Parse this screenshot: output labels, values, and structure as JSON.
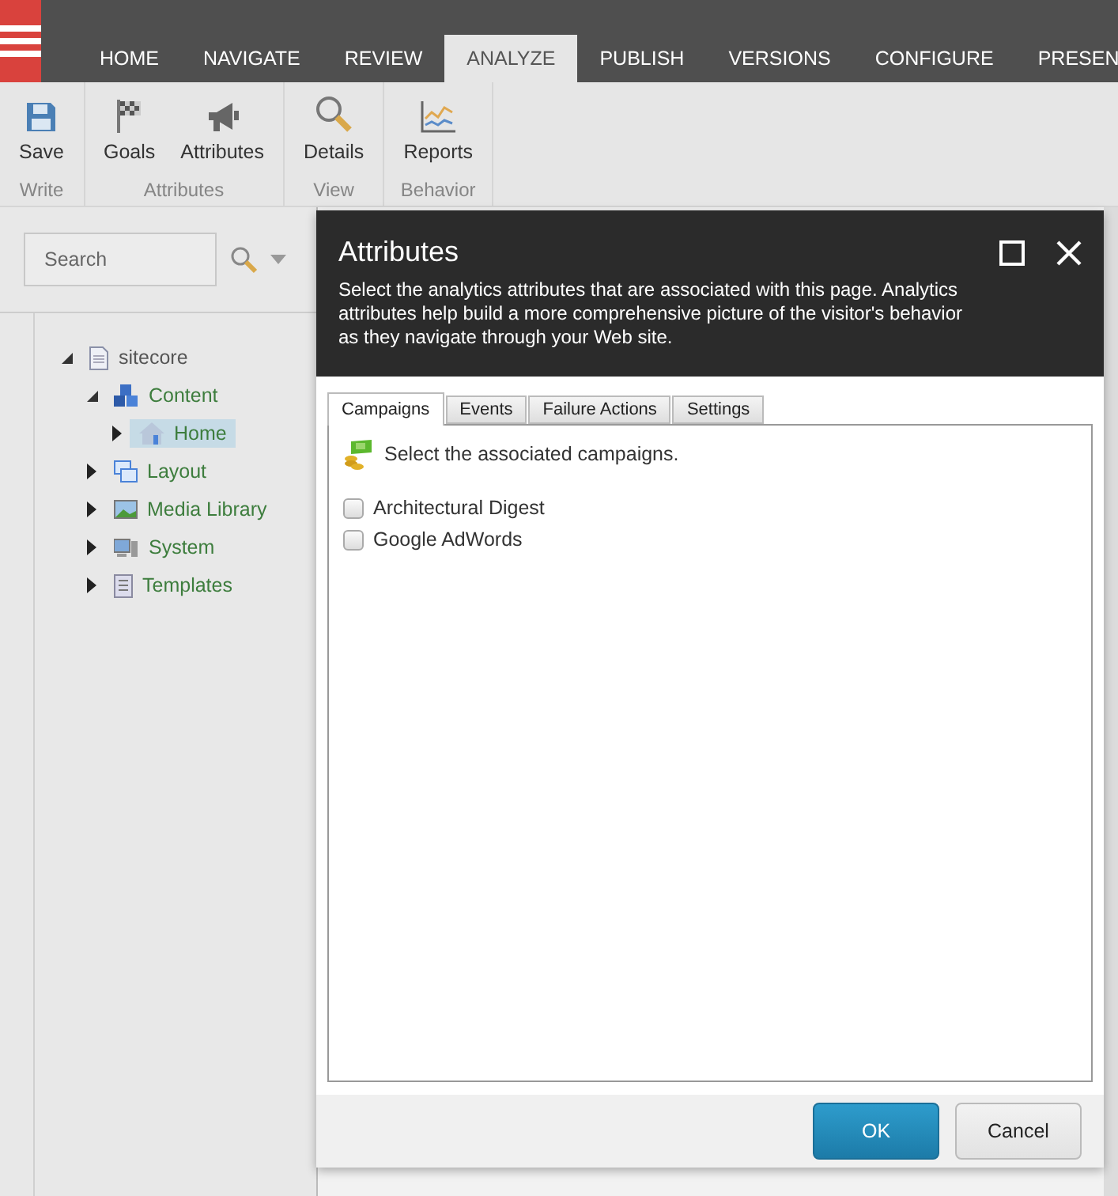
{
  "nav_tabs": [
    {
      "label": "HOME",
      "selected": false
    },
    {
      "label": "NAVIGATE",
      "selected": false
    },
    {
      "label": "REVIEW",
      "selected": false
    },
    {
      "label": "ANALYZE",
      "selected": true
    },
    {
      "label": "PUBLISH",
      "selected": false
    },
    {
      "label": "VERSIONS",
      "selected": false
    },
    {
      "label": "CONFIGURE",
      "selected": false
    },
    {
      "label": "PRESEN",
      "selected": false
    }
  ],
  "ribbon": [
    {
      "label": "Write",
      "buttons": [
        "Save"
      ]
    },
    {
      "label": "Attributes",
      "buttons": [
        "Goals",
        "Attributes"
      ]
    },
    {
      "label": "View",
      "buttons": [
        "Details"
      ]
    },
    {
      "label": "Behavior",
      "buttons": [
        "Reports"
      ]
    }
  ],
  "search": {
    "placeholder": "Search"
  },
  "tree": [
    {
      "label": "sitecore",
      "expanded": true,
      "selected": false,
      "children": [
        {
          "label": "Content",
          "expanded": true,
          "selected": false,
          "children": [
            {
              "label": "Home",
              "expanded": false,
              "selected": true
            }
          ]
        },
        {
          "label": "Layout",
          "expanded": false,
          "selected": false
        },
        {
          "label": "Media Library",
          "expanded": false,
          "selected": false
        },
        {
          "label": "System",
          "expanded": false,
          "selected": false
        },
        {
          "label": "Templates",
          "expanded": false,
          "selected": false
        }
      ]
    }
  ],
  "dialog": {
    "title": "Attributes",
    "description": "Select the analytics attributes that are associated with this page. Analytics attributes help build a more comprehensive picture of the visitor's behavior as they navigate through your Web site.",
    "tabs": [
      {
        "label": "Campaigns",
        "selected": true
      },
      {
        "label": "Events",
        "selected": false
      },
      {
        "label": "Failure Actions",
        "selected": false
      },
      {
        "label": "Settings",
        "selected": false
      }
    ],
    "heading": "Select the associated campaigns.",
    "options": [
      {
        "label": "Architectural Digest",
        "checked": false
      },
      {
        "label": "Google AdWords",
        "checked": false
      }
    ],
    "buttons": [
      {
        "label": "OK",
        "kind": "primary"
      },
      {
        "label": "Cancel",
        "kind": "secondary"
      }
    ]
  }
}
